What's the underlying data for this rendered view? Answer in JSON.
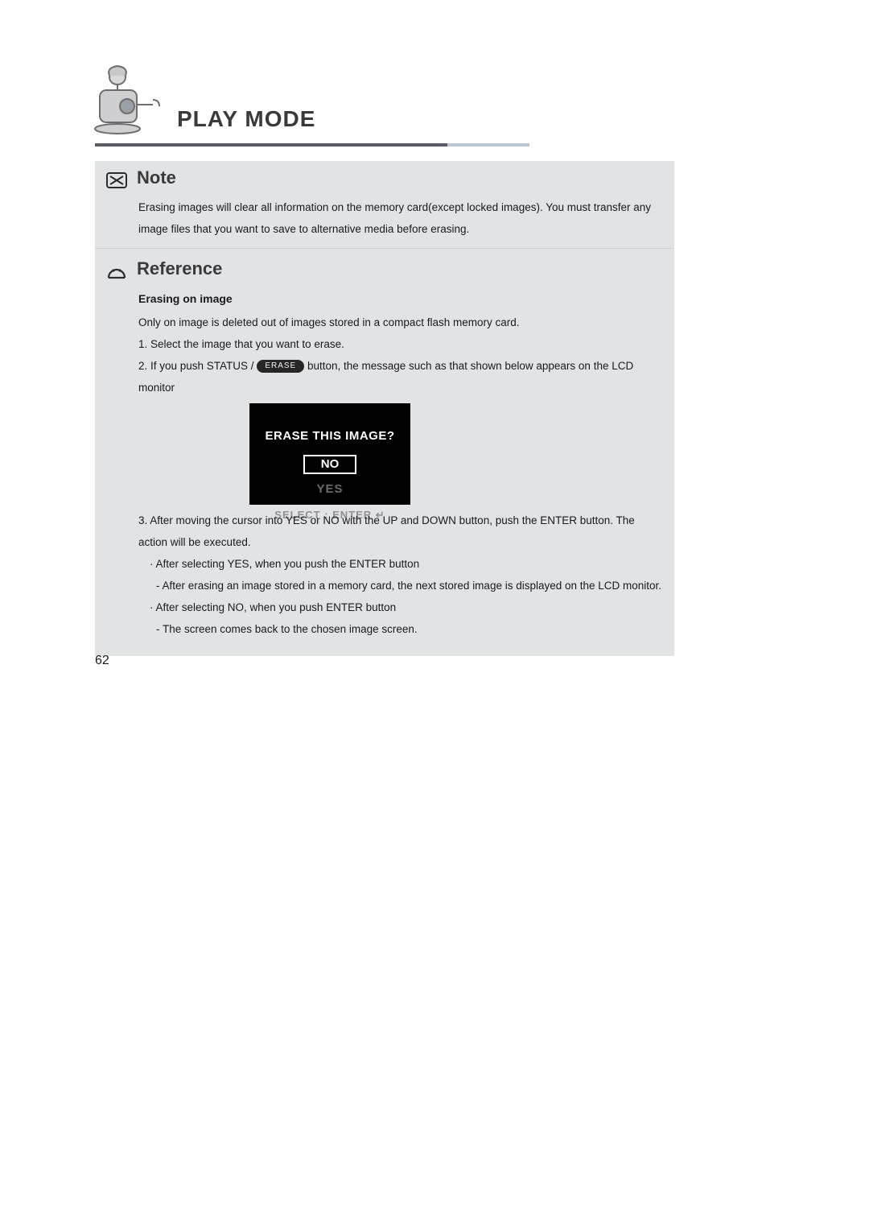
{
  "header": {
    "title": "PLAY MODE"
  },
  "note": {
    "heading": "Note",
    "body": "Erasing images will clear all information on the memory card(except locked images). You must transfer any image files that you want to save to alternative media before erasing."
  },
  "reference": {
    "heading": "Reference",
    "subhead": "Erasing on image",
    "intro": "Only on image is deleted out of images stored in a compact flash memory card.",
    "step1": "1. Select the image that you want to erase.",
    "step2_pre": "2. If you push STATUS / ",
    "erase_pill": "ERASE",
    "step2_post": " button, the message such as that shown below appears on the LCD monitor",
    "lcd": {
      "question": "ERASE THIS IMAGE?",
      "no": "NO",
      "yes": "YES",
      "select": "SELECT : ENTER ↵"
    },
    "step3": "3. After moving the cursor into YES or NO with the UP and DOWN button, push the ENTER button. The action will be executed.",
    "b1": "· After selecting YES, when you push the ENTER button",
    "b1a": "- After erasing an image stored in a memory card, the next stored image is displayed on the LCD monitor.",
    "b2": "· After selecting NO, when you push ENTER button",
    "b2a": "- The screen comes back to the chosen image screen."
  },
  "page_number": "62"
}
